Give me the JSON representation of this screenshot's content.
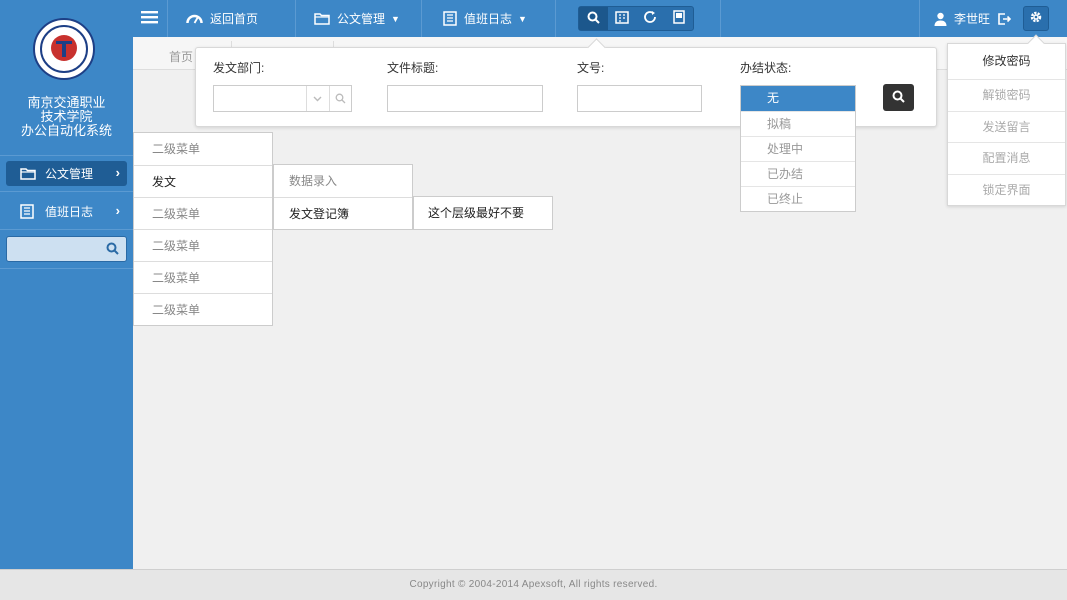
{
  "school": {
    "logo_icon": "school-emblem-icon",
    "name_lines": [
      "南京交通职业",
      "技术学院",
      "办公自动化系统"
    ]
  },
  "sidebar": {
    "items": [
      {
        "label": "公文管理",
        "icon": "folder-icon",
        "active": true
      },
      {
        "label": "值班日志",
        "icon": "book-icon",
        "active": false
      }
    ],
    "search_placeholder": ""
  },
  "topbar": {
    "home_label": "返回首页",
    "doc_mgmt_label": "公文管理",
    "duty_log_label": "值班日志",
    "tools": [
      "search-icon",
      "form-icon",
      "refresh-icon",
      "archive-icon"
    ],
    "user_name": "李世旺"
  },
  "breadcrumb": {
    "home": "首页"
  },
  "search_panel": {
    "dept_label": "发文部门:",
    "title_label": "文件标题:",
    "docno_label": "文号:",
    "status_label": "办结状态:",
    "dept_value": "",
    "title_value": "",
    "docno_value": ""
  },
  "status_options": [
    "无",
    "拟稿",
    "处理中",
    "已办结",
    "已终止"
  ],
  "gear_menu": [
    "修改密码",
    "解锁密码",
    "发送留言",
    "配置消息",
    "锁定界面"
  ],
  "menu_level1": [
    "二级菜单",
    "发文",
    "二级菜单",
    "二级菜单",
    "二级菜单",
    "二级菜单"
  ],
  "menu_level2": [
    "数据录入",
    "发文登记簿"
  ],
  "menu_level3": [
    "这个层级最好不要"
  ],
  "footer": {
    "copyright": "Copyright © 2004-2014 Apexsoft, All rights reserved."
  },
  "colors": {
    "brand_blue": "#3d87c7",
    "active_blue": "#1f5d95",
    "dark_button": "#333333"
  }
}
